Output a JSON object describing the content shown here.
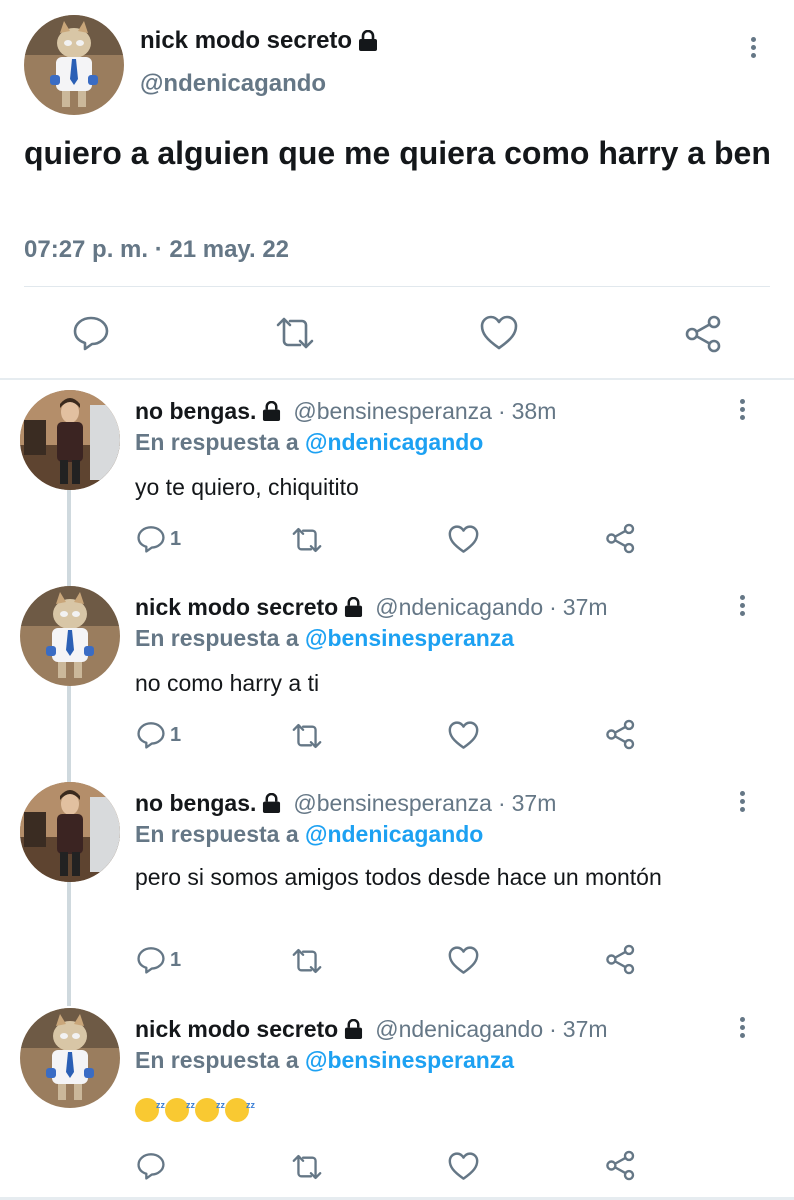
{
  "main_tweet": {
    "display_name": "nick modo secreto",
    "handle": "@ndenicagando",
    "text": "quiero a alguien que me quiera como harry a ben",
    "timestamp": "07:27 p. m. · 21 may. 22",
    "avatar": "cat-in-shirt-avatar",
    "locked": true
  },
  "replies": [
    {
      "display_name": "no bengas.",
      "handle": "@bensinesperanza",
      "time": "38m",
      "reply_prefix": "En respuesta a ",
      "reply_to": "@ndenicagando",
      "text": "yo te quiero, chiquitito",
      "reply_count": "1",
      "avatar": "person-in-room-avatar"
    },
    {
      "display_name": "nick modo secreto",
      "handle": "@ndenicagando",
      "time": "37m",
      "reply_prefix": "En respuesta a ",
      "reply_to": "@bensinesperanza",
      "text": "no como harry a ti",
      "reply_count": "1",
      "avatar": "cat-in-shirt-avatar"
    },
    {
      "display_name": "no bengas.",
      "handle": "@bensinesperanza",
      "time": "37m",
      "reply_prefix": "En respuesta a ",
      "reply_to": "@ndenicagando",
      "text": "pero si somos amigos todos desde hace un montón",
      "reply_count": "1",
      "avatar": "person-in-room-avatar"
    },
    {
      "display_name": "nick modo secreto",
      "handle": "@ndenicagando",
      "time": "37m",
      "reply_prefix": "En respuesta a ",
      "reply_to": "@bensinesperanza",
      "text": "",
      "emojis": [
        "sleeping-face",
        "sleeping-face",
        "sleeping-face",
        "sleeping-face"
      ],
      "reply_count": "",
      "avatar": "cat-in-shirt-avatar"
    }
  ],
  "icons": {
    "reply": "comment-icon",
    "retweet": "retweet-icon",
    "like": "heart-icon",
    "share": "share-icon",
    "lock": "lock-icon",
    "more": "more-vertical-icon"
  },
  "colors": {
    "text": "#14171a",
    "secondary": "#657786",
    "mention": "#1da1f2",
    "divider": "#e1e8ed"
  }
}
